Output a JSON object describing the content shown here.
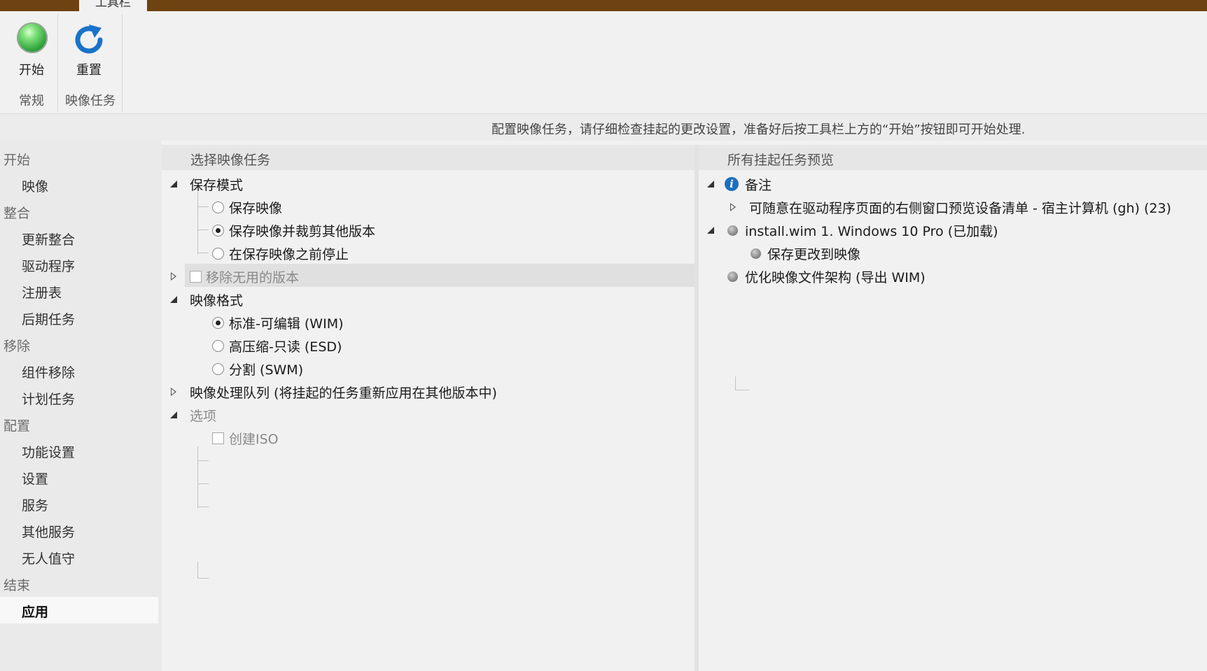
{
  "ribbon": {
    "tab_label": "工具栏",
    "start_label": "开始",
    "reset_label": "重置",
    "group_general": "常规",
    "group_image_tasks": "映像任务"
  },
  "info_text": "配置映像任务，请仔细检查挂起的更改设置，准备好后按工具栏上方的“开始”按钮即可开始处理.",
  "sidebar": {
    "items": [
      {
        "label": "开始",
        "kind": "category"
      },
      {
        "label": "映像",
        "kind": "item"
      },
      {
        "label": "整合",
        "kind": "category"
      },
      {
        "label": "更新整合",
        "kind": "item"
      },
      {
        "label": "驱动程序",
        "kind": "item"
      },
      {
        "label": "注册表",
        "kind": "item"
      },
      {
        "label": "后期任务",
        "kind": "item"
      },
      {
        "label": "移除",
        "kind": "category"
      },
      {
        "label": "组件移除",
        "kind": "item"
      },
      {
        "label": "计划任务",
        "kind": "item"
      },
      {
        "label": "配置",
        "kind": "category"
      },
      {
        "label": "功能设置",
        "kind": "item"
      },
      {
        "label": "设置",
        "kind": "item"
      },
      {
        "label": "服务",
        "kind": "item"
      },
      {
        "label": "其他服务",
        "kind": "item"
      },
      {
        "label": "无人值守",
        "kind": "item"
      },
      {
        "label": "结束",
        "kind": "category"
      },
      {
        "label": "应用",
        "kind": "item",
        "active": true
      }
    ]
  },
  "left_panel": {
    "header": "选择映像任务",
    "save_mode": {
      "label": "保存模式",
      "options": [
        {
          "label": "保存映像",
          "checked": false
        },
        {
          "label": "保存映像并裁剪其他版本",
          "checked": true
        },
        {
          "label": "在保存映像之前停止",
          "checked": false
        }
      ]
    },
    "remove_unused": {
      "label": "移除无用的版本",
      "checked": false
    },
    "image_format": {
      "label": "映像格式",
      "options": [
        {
          "label": "标准-可编辑 (WIM)",
          "checked": true
        },
        {
          "label": "高压缩-只读 (ESD)",
          "checked": false
        },
        {
          "label": "分割 (SWM)",
          "checked": false
        }
      ]
    },
    "queue": {
      "label": "映像处理队列 (将挂起的任务重新应用在其他版本中)"
    },
    "options": {
      "label": "选项",
      "create_iso": {
        "label": "创建ISO",
        "checked": false
      }
    }
  },
  "right_panel": {
    "header": "所有挂起任务预览",
    "notes": {
      "label": "备注",
      "child": "可随意在驱动程序页面的右侧窗口预览设备清单 - 宿主计算机 (gh) (23)"
    },
    "image": {
      "label": "install.wim 1. Windows 10 Pro  (已加载)",
      "child": "保存更改到映像"
    },
    "optimize": {
      "label": "优化映像文件架构 (导出 WIM)"
    }
  },
  "colors": {
    "titlebar": "#6e4211",
    "background": "#f1f1f1",
    "sidebar": "#eaeaea",
    "info_icon": "#1b6fc0"
  }
}
